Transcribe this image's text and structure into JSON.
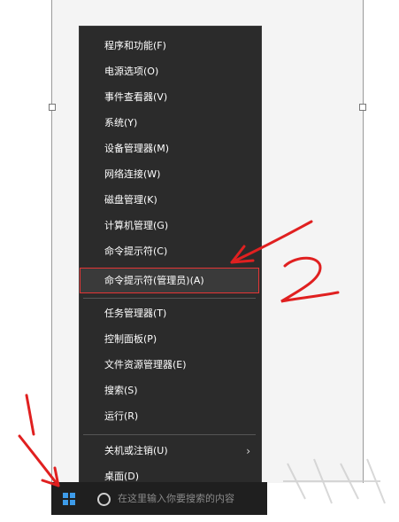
{
  "menu": {
    "items": [
      {
        "label": "程序和功能(F)"
      },
      {
        "label": "电源选项(O)"
      },
      {
        "label": "事件查看器(V)"
      },
      {
        "label": "系统(Y)"
      },
      {
        "label": "设备管理器(M)"
      },
      {
        "label": "网络连接(W)"
      },
      {
        "label": "磁盘管理(K)"
      },
      {
        "label": "计算机管理(G)"
      },
      {
        "label": "命令提示符(C)"
      },
      {
        "label": "命令提示符(管理员)(A)",
        "highlighted": true
      },
      {
        "label": "任务管理器(T)"
      },
      {
        "label": "控制面板(P)"
      },
      {
        "label": "文件资源管理器(E)"
      },
      {
        "label": "搜索(S)"
      },
      {
        "label": "运行(R)"
      },
      {
        "label": "关机或注销(U)",
        "has_submenu": true
      },
      {
        "label": "桌面(D)"
      }
    ]
  },
  "taskbar": {
    "search_placeholder": "在这里输入你要搜索的内容"
  },
  "annotations": {
    "label_1": "1",
    "label_2": "2",
    "color": "#e02020"
  },
  "colors": {
    "menu_bg": "#2b2b2b",
    "highlight_border": "#e53535",
    "windows_blue": "#3d9be9"
  }
}
